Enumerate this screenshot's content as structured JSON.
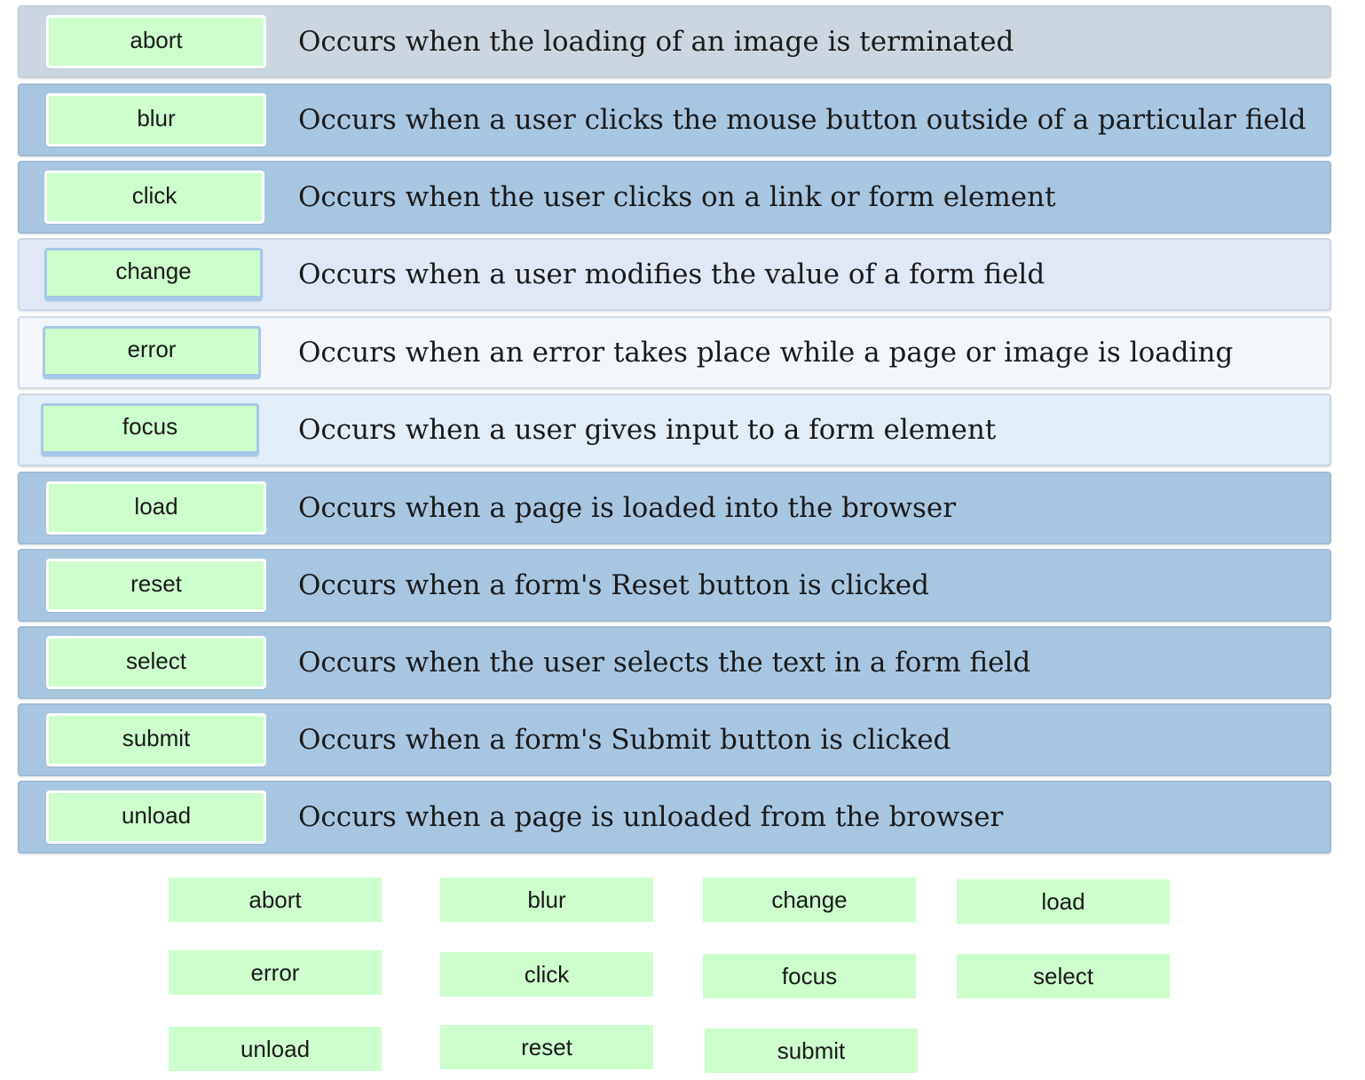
{
  "rows": [
    {
      "term": "abort",
      "definition": "Occurs when the loading of an image is terminated"
    },
    {
      "term": "blur",
      "definition": "Occurs when a user clicks the mouse button outside of a particular field"
    },
    {
      "term": "click",
      "definition": "Occurs when the user clicks on a link or form element"
    },
    {
      "term": "change",
      "definition": "Occurs when a user modifies the value of a form field"
    },
    {
      "term": "error",
      "definition": "Occurs when an error takes place while a page or image is loading"
    },
    {
      "term": "focus",
      "definition": "Occurs when a user gives input to a form element"
    },
    {
      "term": "load",
      "definition": "Occurs when a page is loaded into the browser"
    },
    {
      "term": "reset",
      "definition": "Occurs when a form's Reset button is clicked"
    },
    {
      "term": "select",
      "definition": "Occurs when the user selects the text in a form field"
    },
    {
      "term": "submit",
      "definition": "Occurs when a form's Submit button is clicked"
    },
    {
      "term": "unload",
      "definition": "Occurs when a page is unloaded from the browser"
    }
  ],
  "bank": [
    "abort",
    "blur",
    "change",
    "load",
    "error",
    "click",
    "focus",
    "select",
    "unload",
    "reset",
    "submit"
  ],
  "colors": {
    "chip": "#ccffcc",
    "row_neutral": "#ccd6e0",
    "row_filled": "#a9c6e1",
    "row_pale": "#e0e7f5",
    "row_white": "#f3f7fc",
    "row_light": "#e1edf7"
  }
}
